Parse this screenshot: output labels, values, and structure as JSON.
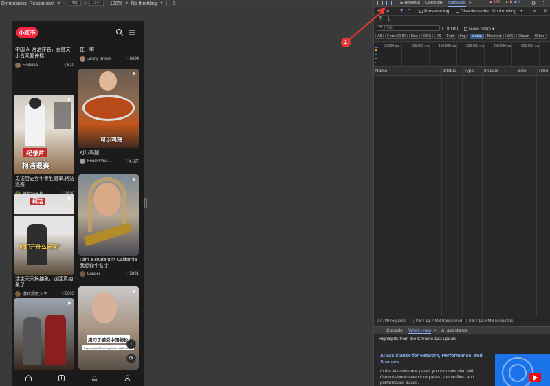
{
  "device_toolbar": {
    "dimensions_label": "Dimensions: Responsive",
    "width": "400",
    "height": "1104",
    "zoom": "100%",
    "throttle": "No throttling"
  },
  "app": {
    "logo": "小红书",
    "nav": [
      "home-icon",
      "add-icon",
      "bell-icon",
      "user-icon"
    ]
  },
  "feed": {
    "left": [
      {
        "title": "中国 AI 月活排名，百度文小言又要神标！",
        "author": "Heikepai",
        "likes": "510"
      },
      {
        "title": "见证历史券个零胜冠军,柯洁退赛",
        "author": "韩世纪录片",
        "likes": "2690",
        "overlay1": "纪录片",
        "overlay2": "柯洁退赛"
      },
      {
        "title": "活宝天天搞抽象，这回真抽象了",
        "author": "游戏提取大王",
        "likes": "3603",
        "overlay1": "柯洁",
        "overlay2": "你们开什么玩笑？"
      },
      {
        "title": "",
        "author": "",
        "likes": ""
      }
    ],
    "right": [
      {
        "title": "在干嘛",
        "author": "Jenny Brown",
        "likes": "6684"
      },
      {
        "title": "可乐鸡翅",
        "author": "Food4Paul...",
        "likes": "4.8万",
        "overlay1": "可乐鸡翅"
      },
      {
        "title": "I am a student in California我想你个名字",
        "author": "Lander",
        "likes": "5891"
      },
      {
        "title": "",
        "author": "",
        "likes": "",
        "overlay1": "用刀了感受中国物价",
        "overlay2": "Experience Chinese prices in US dollars"
      }
    ]
  },
  "devtools": {
    "tabs": [
      "Elements",
      "Console",
      "Network"
    ],
    "active_tab": "Network",
    "errors": "353",
    "warnings": "6",
    "info": "1",
    "preserve_log": "Preserve log",
    "disable_cache": "Disable cache",
    "throttling": "No throttling",
    "filter_placeholder": "Filter",
    "invert": "Invert",
    "more_filters": "More filters",
    "filter_chips": [
      "All",
      "Fetch/XHR",
      "Doc",
      "CSS",
      "JS",
      "Font",
      "Img",
      "Media",
      "Manifest",
      "WS",
      "Wasm",
      "Other"
    ],
    "active_chip": "Media",
    "timeline_ticks": [
      "50,000 ms",
      "100,000 ms",
      "150,000 ms",
      "200,000 ms",
      "250,000 ms",
      "300,000 ms"
    ],
    "columns": [
      "Name",
      "Status",
      "Type",
      "Initiator",
      "Size",
      "Time"
    ],
    "status": {
      "requests": "0 / 709 requests",
      "transferred": "0 B / 13.7 MB transferred",
      "resources": "0 B / 19.6 MB resources"
    },
    "drawer_tabs": [
      "Console",
      "What's new",
      "AI assistance"
    ],
    "whats_new": {
      "header": "Highlights from the Chrome 132 update",
      "title": "AI assistance for Network, Performance, and Sources",
      "body": "In the AI assistance panel, you can now chat with Gemini about network requests, source files, and performance traces."
    }
  },
  "annotation": {
    "number": "1",
    "color": "#e53935"
  }
}
